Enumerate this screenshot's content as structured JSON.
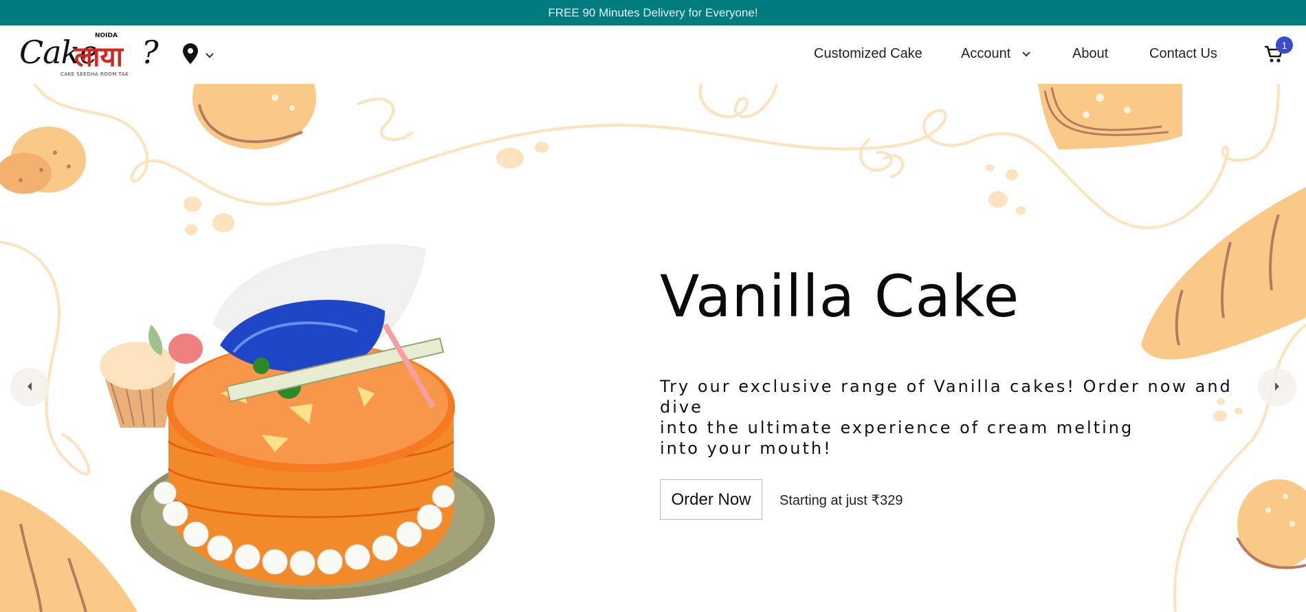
{
  "announcement": "FREE 90 Minutes Delivery for Everyone!",
  "brand": {
    "name_en": "Cake",
    "name_hi": "लाया",
    "name_q": "?",
    "city": "NOIDA",
    "tagline": "CAKE SEEDHA ROOM TAK"
  },
  "nav": {
    "customized_cake": "Customized Cake",
    "account": "Account",
    "about": "About",
    "contact": "Contact Us"
  },
  "cart": {
    "count": "1"
  },
  "hero": {
    "title": "Vanilla Cake",
    "description": "Try our exclusive range of Vanilla cakes! Order now and dive\ninto the ultimate experience of cream melting\ninto your mouth!",
    "cta": "Order Now",
    "price": "Starting at just ₹329"
  },
  "colors": {
    "topbar": "#007b7e",
    "accent_orange": "#fbc987",
    "doodle_line": "#fde3bd",
    "badge": "#3a4bcf"
  },
  "icons": {
    "location": "location-pin-icon",
    "dropdown": "chevron-down-icon",
    "cart": "cart-icon",
    "prev": "chevron-left-icon",
    "next": "chevron-right-icon"
  }
}
